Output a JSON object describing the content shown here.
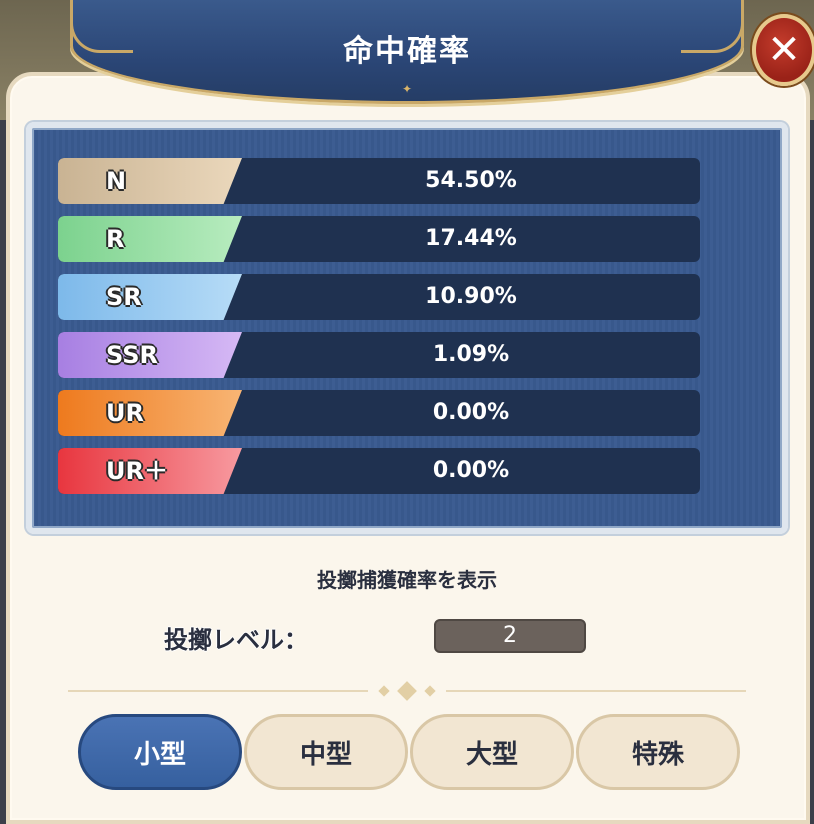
{
  "dialog": {
    "title": "命中確率",
    "close_label": "✕"
  },
  "rates": [
    {
      "label": "N",
      "value": "54.50%",
      "color_start": "#c9b393",
      "color_end": "#ebd8bc"
    },
    {
      "label": "R",
      "value": "17.44%",
      "color_start": "#7cd28e",
      "color_end": "#b8ecbf"
    },
    {
      "label": "SR",
      "value": "10.90%",
      "color_start": "#7db9ea",
      "color_end": "#b7dcf7"
    },
    {
      "label": "SSR",
      "value": "1.09%",
      "color_start": "#a77fe2",
      "color_end": "#d6b9f5"
    },
    {
      "label": "UR",
      "value": "0.00%",
      "color_start": "#ee7a1e",
      "color_end": "#f8b574"
    },
    {
      "label": "UR＋",
      "value": "0.00%",
      "color_start": "#e8363f",
      "color_end": "#f79aa0"
    }
  ],
  "capture_toggle": "投擲捕獲確率を表示",
  "throw_level": {
    "label": "投擲レベル：",
    "value": "2"
  },
  "tabs": [
    {
      "label": "小型",
      "active": true
    },
    {
      "label": "中型",
      "active": false
    },
    {
      "label": "大型",
      "active": false
    },
    {
      "label": "特殊",
      "active": false
    }
  ],
  "colors": {
    "accent": "#36609f",
    "panel": "#3d5d92",
    "gold": "#c9a867"
  }
}
